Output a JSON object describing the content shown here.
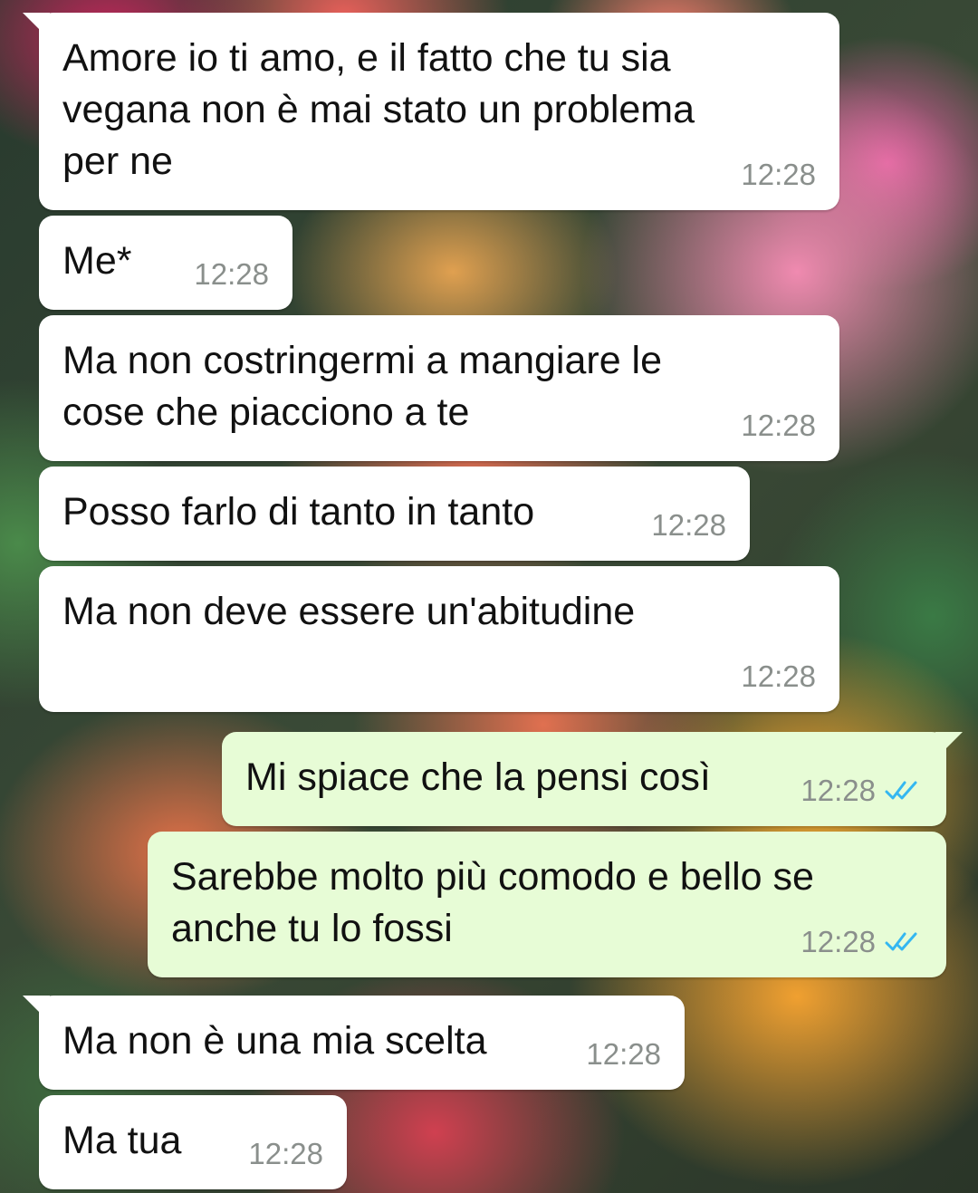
{
  "messages": [
    {
      "text": "Amore io ti amo, e il fatto che tu sia\nvegana non è mai stato un problema\nper ne",
      "time": "12:28"
    },
    {
      "text": "Me*",
      "time": "12:28"
    },
    {
      "text": "Ma non costringermi a mangiare le\ncose che piacciono a te",
      "time": "12:28"
    },
    {
      "text": "Posso farlo di tanto in tanto",
      "time": "12:28"
    },
    {
      "text": "Ma non deve essere un'abitudine",
      "time": "12:28"
    },
    {
      "text": "Mi spiace che la pensi così",
      "time": "12:28"
    },
    {
      "text": "Sarebbe molto più comodo e bello se\nanche tu lo fossi",
      "time": "12:28"
    },
    {
      "text": "Ma non è una mia scelta",
      "time": "12:28"
    },
    {
      "text": "Ma tua",
      "time": "12:28"
    }
  ],
  "colors": {
    "incoming_bubble": "#ffffff",
    "outgoing_bubble": "#e7fcd6",
    "read_ticks": "#34b7f1",
    "timestamp": "#8a8f8c"
  },
  "icons": {
    "read_receipt": "double-check-icon"
  }
}
